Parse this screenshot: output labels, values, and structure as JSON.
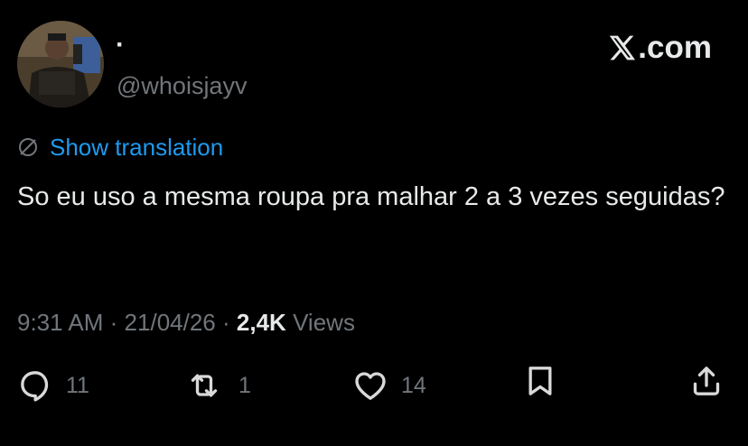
{
  "post": {
    "display_name": "·",
    "handle": "@whoisjayv",
    "brand": ".com",
    "show_translation": "Show translation",
    "text": "So eu uso a mesma roupa pra malhar 2 a 3 vezes seguidas?",
    "time": "9:31 AM",
    "separator": "·",
    "date": "21/04/26",
    "views_count": "2,4K",
    "views_label": "Views"
  },
  "actions": {
    "replies": "11",
    "reposts": "1",
    "likes": "14"
  },
  "icons": [
    "x-logo-icon",
    "translate-icon",
    "reply-icon",
    "repost-icon",
    "like-icon",
    "bookmark-icon",
    "share-icon"
  ],
  "colors": {
    "background": "#000000",
    "text": "#e7e9ea",
    "muted": "#71767b",
    "link": "#1d9bf0"
  }
}
